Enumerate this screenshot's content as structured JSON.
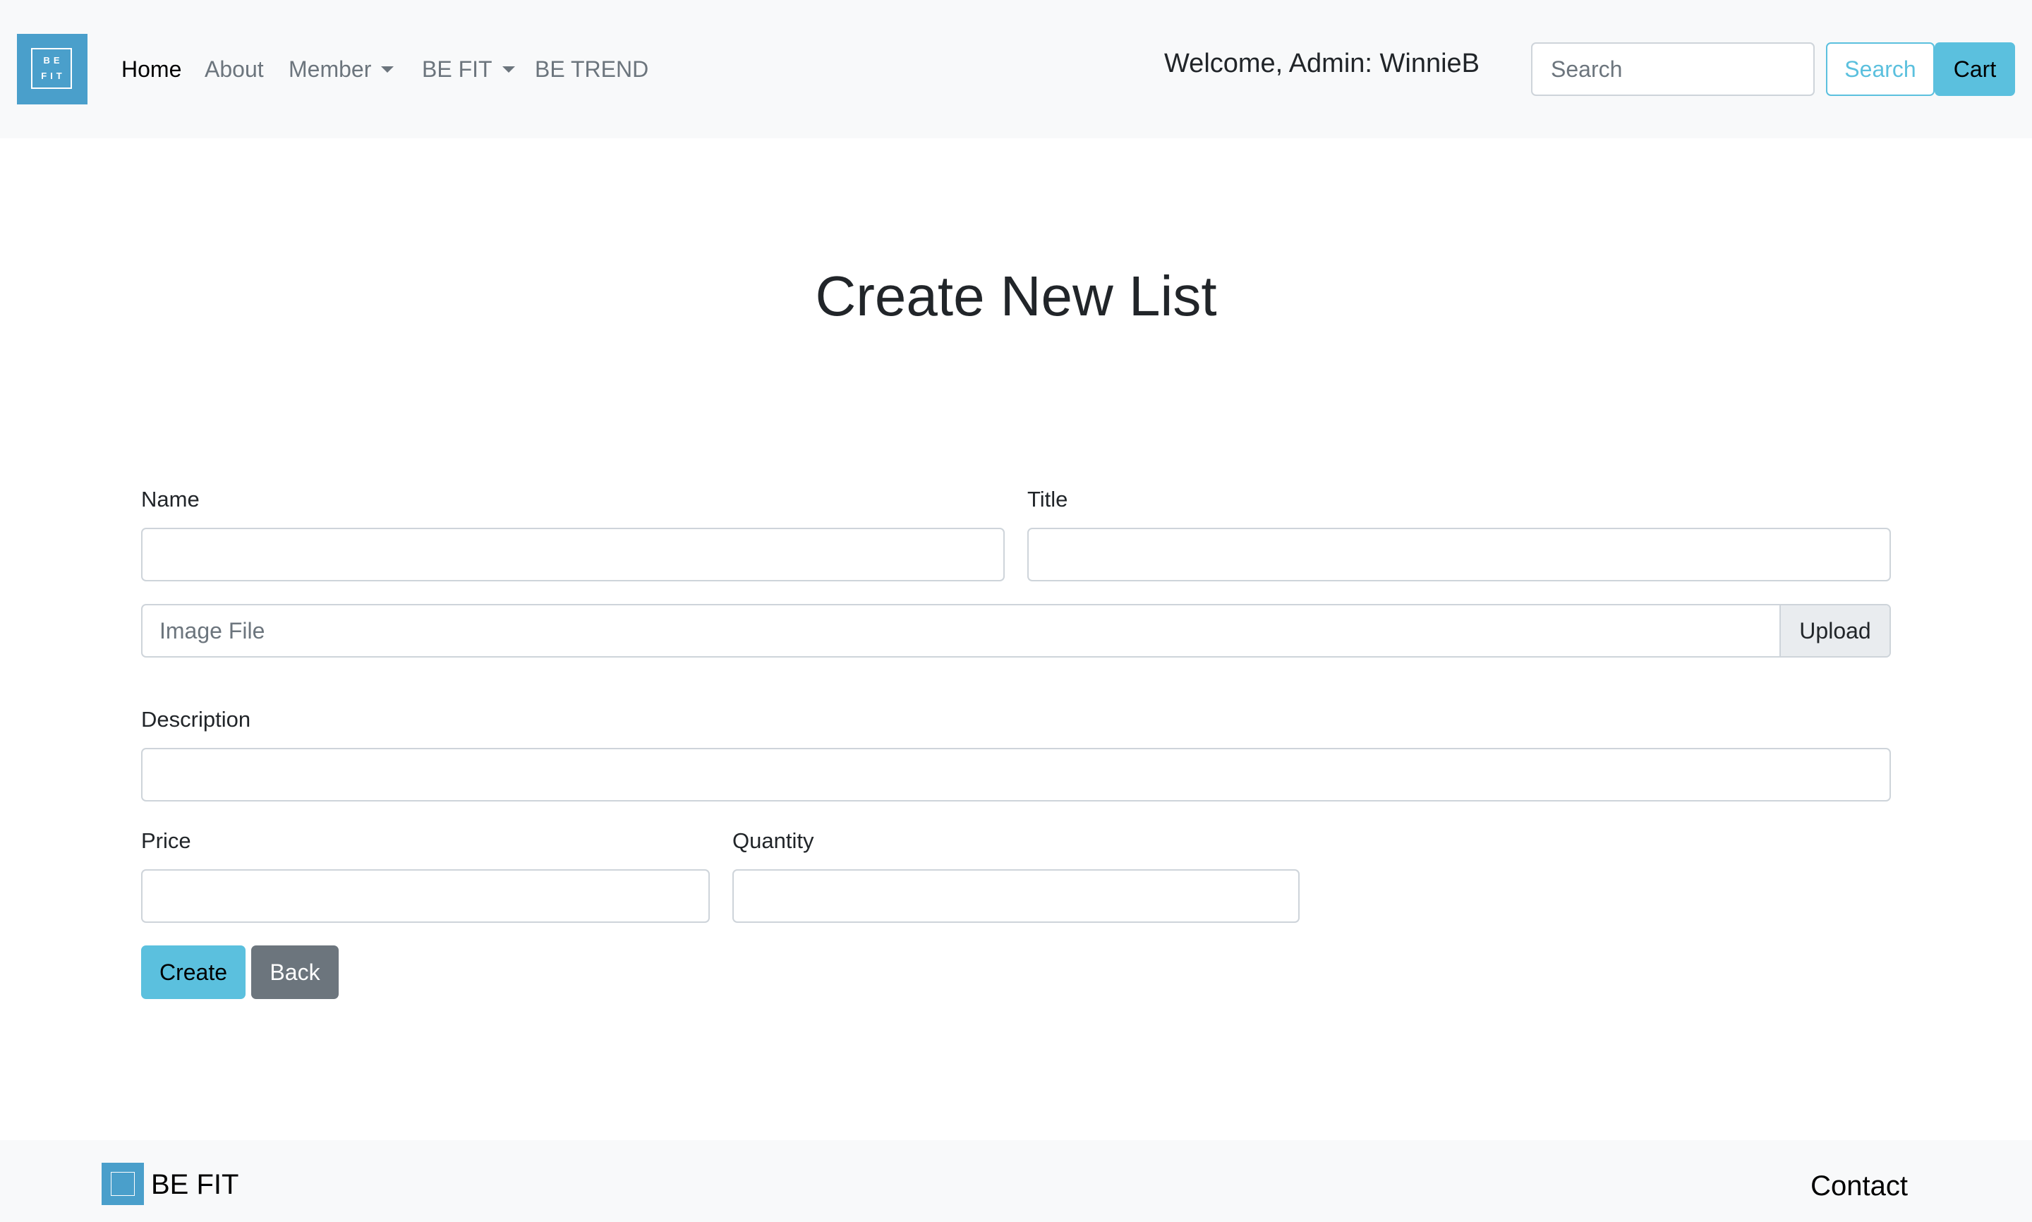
{
  "navbar": {
    "logo": {
      "line1": "BE",
      "line2": "FIT"
    },
    "links": [
      {
        "label": "Home",
        "active": true,
        "dropdown": false
      },
      {
        "label": "About",
        "active": false,
        "dropdown": false
      },
      {
        "label": "Member",
        "active": false,
        "dropdown": true
      },
      {
        "label": "BE FIT",
        "active": false,
        "dropdown": true
      },
      {
        "label": "BE TREND",
        "active": false,
        "dropdown": false
      }
    ],
    "welcome": "Welcome, Admin: WinnieB",
    "search": {
      "placeholder": "Search",
      "value": ""
    },
    "search_button": "Search",
    "cart_button": "Cart"
  },
  "page": {
    "title": "Create New List"
  },
  "form": {
    "name": {
      "label": "Name",
      "value": ""
    },
    "title": {
      "label": "Title",
      "value": ""
    },
    "image_file": {
      "placeholder": "Image File",
      "upload_label": "Upload"
    },
    "description": {
      "label": "Description",
      "value": ""
    },
    "price": {
      "label": "Price",
      "value": ""
    },
    "quantity": {
      "label": "Quantity",
      "value": ""
    },
    "create_button": "Create",
    "back_button": "Back"
  },
  "footer": {
    "brand": "BE FIT",
    "contact": "Contact"
  },
  "colors": {
    "brand_blue": "#4a9fcb",
    "info": "#5bc0de",
    "secondary": "#6c757d",
    "navbar_bg": "#f8f9fa"
  },
  "icons": [
    "be-fit-logo-icon",
    "caret-down-icon"
  ]
}
